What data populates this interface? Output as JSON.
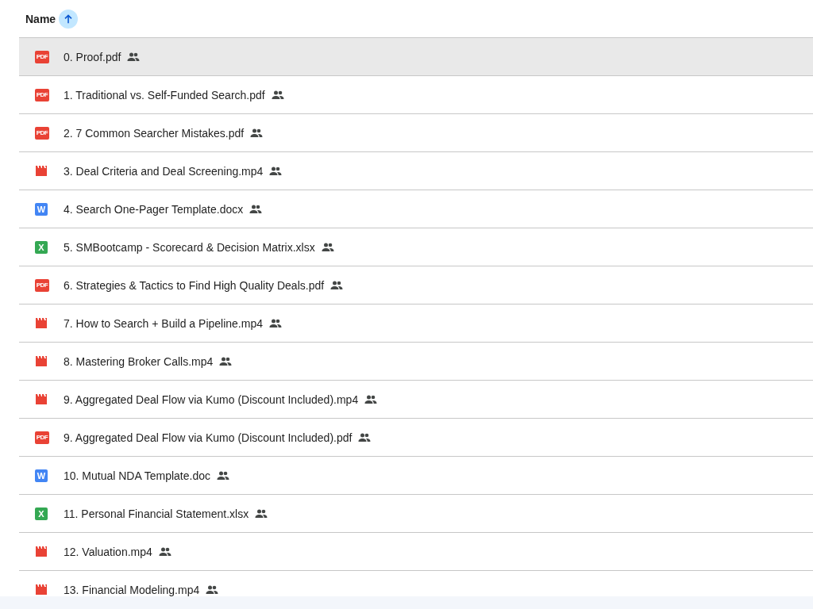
{
  "header": {
    "column_label": "Name",
    "sort_ascending": true
  },
  "files": [
    {
      "name": "0. Proof.pdf",
      "kind": "pdf",
      "icon_text": "PDF",
      "shared": true,
      "selected": true
    },
    {
      "name": "1. Traditional vs. Self-Funded Search.pdf",
      "kind": "pdf",
      "icon_text": "PDF",
      "shared": true,
      "selected": false
    },
    {
      "name": "2. 7 Common Searcher Mistakes.pdf",
      "kind": "pdf",
      "icon_text": "PDF",
      "shared": true,
      "selected": false
    },
    {
      "name": "3. Deal Criteria and Deal Screening.mp4",
      "kind": "video",
      "shared": true,
      "selected": false
    },
    {
      "name": "4. Search One-Pager Template.docx",
      "kind": "doc",
      "icon_text": "W",
      "shared": true,
      "selected": false
    },
    {
      "name": "5. SMBootcamp - Scorecard & Decision Matrix.xlsx",
      "kind": "sheet",
      "icon_text": "X",
      "shared": true,
      "selected": false
    },
    {
      "name": "6. Strategies & Tactics to Find High Quality Deals.pdf",
      "kind": "pdf",
      "icon_text": "PDF",
      "shared": true,
      "selected": false
    },
    {
      "name": "7. How to Search + Build a Pipeline.mp4",
      "kind": "video",
      "shared": true,
      "selected": false
    },
    {
      "name": "8. Mastering Broker Calls.mp4",
      "kind": "video",
      "shared": true,
      "selected": false
    },
    {
      "name": "9. Aggregated Deal Flow via Kumo (Discount Included).mp4",
      "kind": "video",
      "shared": true,
      "selected": false
    },
    {
      "name": "9. Aggregated Deal Flow via Kumo (Discount Included).pdf",
      "kind": "pdf",
      "icon_text": "PDF",
      "shared": true,
      "selected": false
    },
    {
      "name": "10. Mutual NDA Template.doc",
      "kind": "doc",
      "icon_text": "W",
      "shared": true,
      "selected": false
    },
    {
      "name": "11. Personal Financial Statement.xlsx",
      "kind": "sheet",
      "icon_text": "X",
      "shared": true,
      "selected": false
    },
    {
      "name": "12. Valuation.mp4",
      "kind": "video",
      "shared": true,
      "selected": false
    },
    {
      "name": "13. Financial Modeling.mp4",
      "kind": "video",
      "shared": true,
      "selected": false
    }
  ]
}
